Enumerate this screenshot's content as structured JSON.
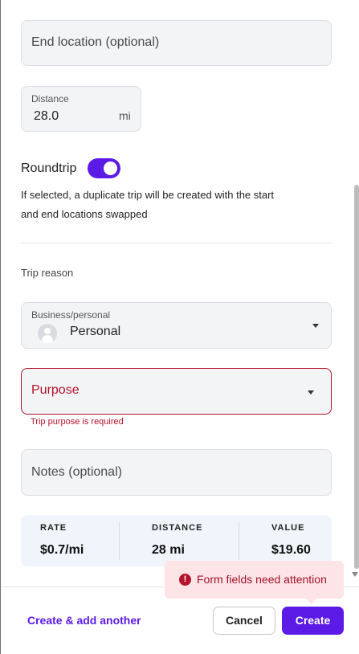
{
  "form": {
    "end_location_placeholder": "End location (optional)",
    "distance": {
      "label": "Distance",
      "value": "28.0",
      "unit": "mi"
    },
    "roundtrip": {
      "label": "Roundtrip",
      "enabled": true,
      "help_line1": "If selected, a duplicate trip will be created with the start",
      "help_line2": "and end locations swapped"
    },
    "trip_reason_heading": "Trip reason",
    "business_personal": {
      "label": "Business/personal",
      "value": "Personal"
    },
    "purpose": {
      "placeholder": "Purpose",
      "error": "Trip purpose is required"
    },
    "notes_placeholder": "Notes (optional)"
  },
  "summary": {
    "rate_label": "RATE",
    "rate_value": "$0.7/mi",
    "distance_label": "DISTANCE",
    "distance_value": "28 mi",
    "value_label": "VALUE",
    "value_value": "$19.60"
  },
  "footer": {
    "create_another": "Create & add another",
    "cancel": "Cancel",
    "create": "Create"
  },
  "toast": {
    "icon": "!",
    "message": "Form fields need attention"
  },
  "colors": {
    "accent": "#5b1ae6",
    "error": "#b3122b",
    "toast_bg": "#fde4e7",
    "summary_bg": "#eff5fa"
  }
}
